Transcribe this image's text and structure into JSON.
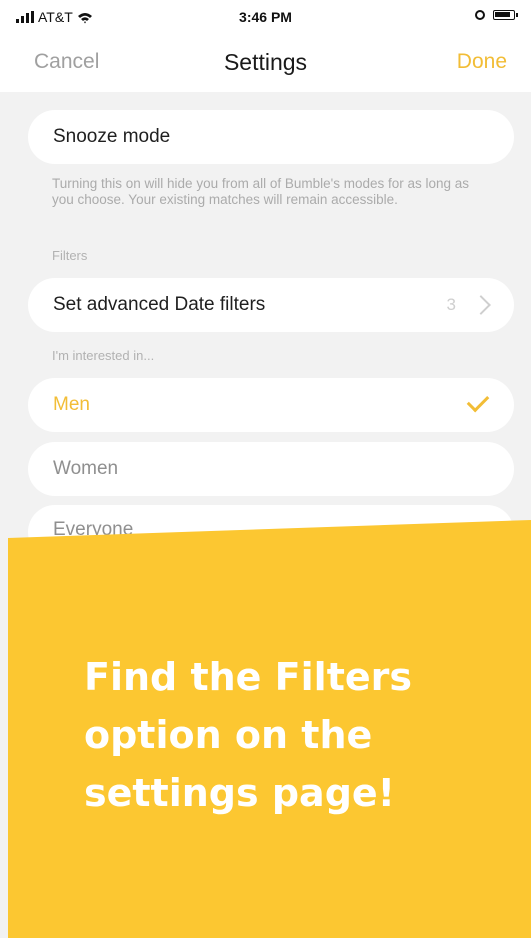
{
  "status_bar": {
    "carrier": "AT&T",
    "time": "3:46 PM"
  },
  "nav": {
    "cancel_label": "Cancel",
    "title": "Settings",
    "done_label": "Done"
  },
  "snooze": {
    "label": "Snooze mode",
    "description": "Turning this on will hide you from all of Bumble's modes for as long as you choose. Your existing matches will remain accessible."
  },
  "filters": {
    "section_label": "Filters",
    "advanced_label": "Set advanced Date filters",
    "advanced_count": "3"
  },
  "interested": {
    "section_label": "I'm interested in...",
    "options": [
      "Men",
      "Women",
      "Everyone"
    ],
    "selected": "Men"
  },
  "promo": {
    "text": "Find the Filters\noption on the\nsettings page!"
  },
  "colors": {
    "accent": "#f2bd36",
    "promo_background": "#fcc731"
  },
  "icons": [
    "signal-icon",
    "wifi-icon",
    "rotation-lock-icon",
    "battery-icon",
    "chevron-right-icon",
    "checkmark-icon"
  ]
}
